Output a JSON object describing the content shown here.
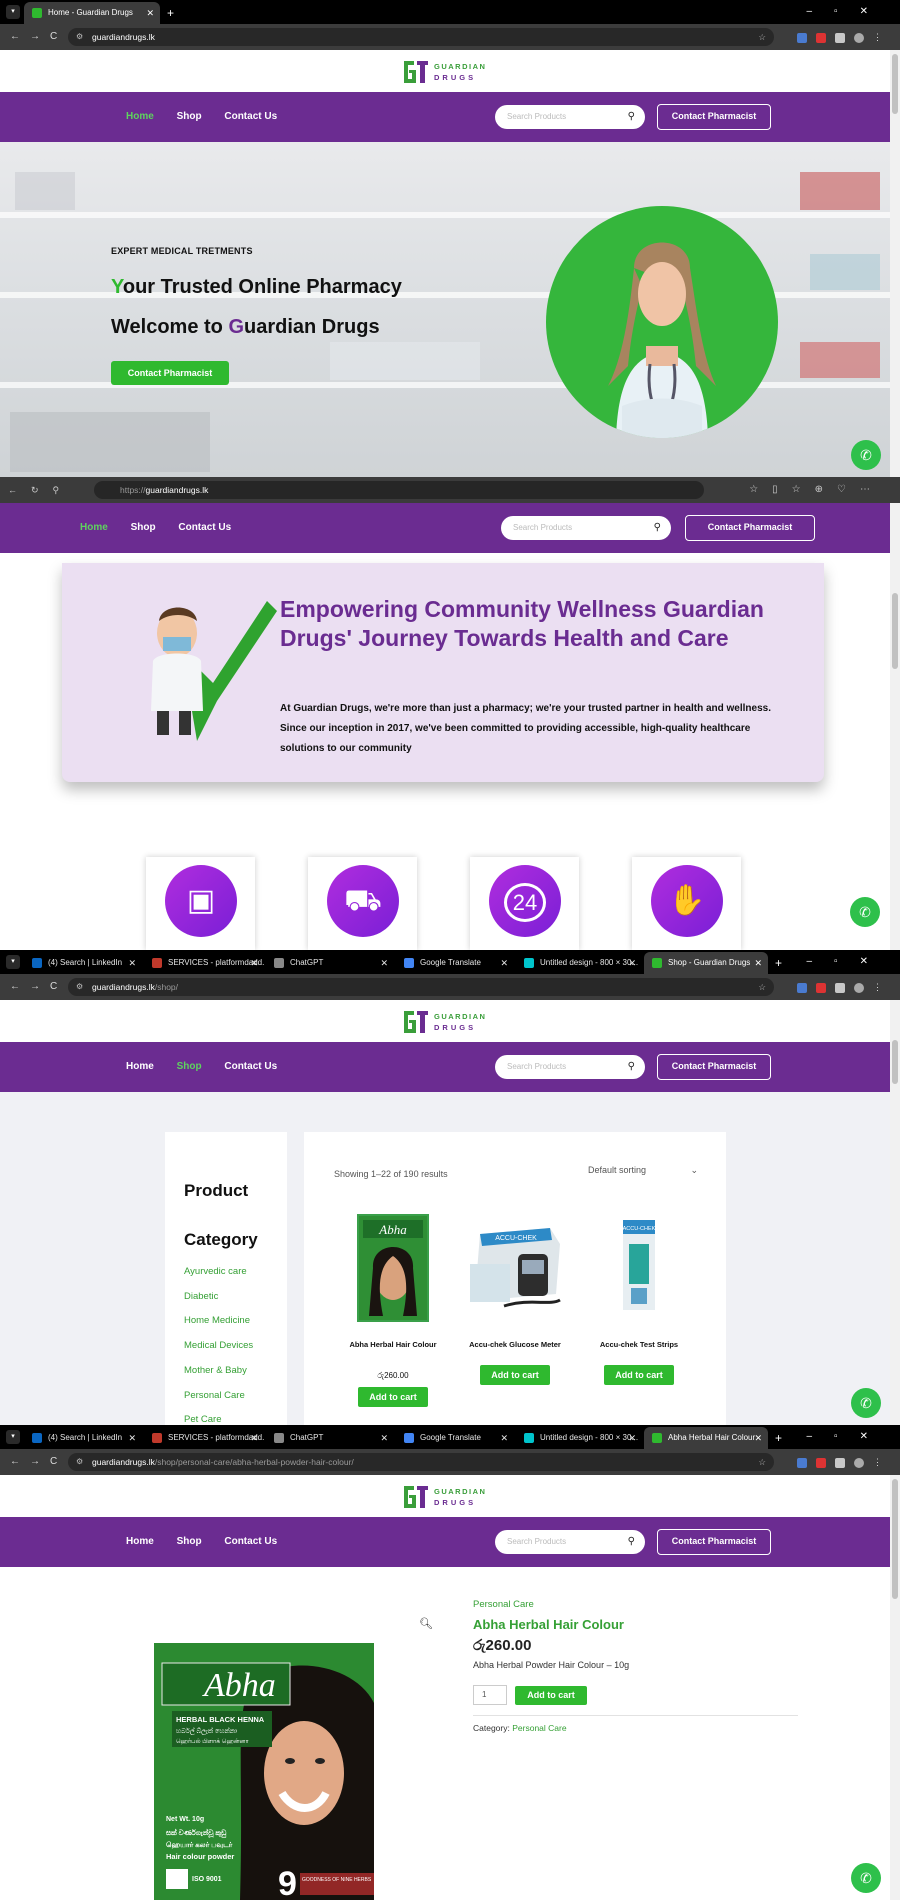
{
  "site": {
    "logo_line1": "GUARDIAN",
    "logo_line2": "DRUGS",
    "nav": [
      "Home",
      "Shop",
      "Contact Us"
    ],
    "search_placeholder": "Search Products",
    "contact_button": "Contact Pharmacist",
    "brand_purple": "#6b2c91",
    "brand_green": "#2fb92f"
  },
  "panel1": {
    "tab_title": "Home - Guardian Drugs",
    "url": "guardiandrugs.lk",
    "hero": {
      "eyebrow": "EXPERT MEDICAL TRETMENTS",
      "headline1_first": "Y",
      "headline1_rest": "our Trusted Online Pharmacy",
      "headline2_a": "Welcome to ",
      "headline2_b": "G",
      "headline2_c": "uardian Drugs",
      "button": "Contact Pharmacist"
    }
  },
  "panel2": {
    "url_prefix": "https://",
    "url_host": "guardiandrugs.lk",
    "about": {
      "heading": "Empowering Community Wellness Guardian Drugs' Journey Towards Health and Care",
      "body": "At Guardian Drugs, we're more than just a pharmacy; we're your trusted partner in health and wellness. Since our inception in 2017, we've been committed to providing accessible, high-quality healthcare solutions to our community"
    },
    "feature_icons": [
      "box-return-icon",
      "delivery-truck-icon",
      "support-24-icon",
      "hand-package-icon"
    ],
    "feature_24_label": "24"
  },
  "tabs_shop": [
    {
      "title": "(4) Search | LinkedIn",
      "color": "#0a66c2"
    },
    {
      "title": "SERVICES - platformdadd...",
      "color": "#c0392b"
    },
    {
      "title": "ChatGPT",
      "color": "#888888"
    },
    {
      "title": "Google Translate",
      "color": "#4285f4"
    },
    {
      "title": "Untitled design - 800 × 30...",
      "color": "#00c4cc"
    }
  ],
  "panel3": {
    "active_tab": "Shop - Guardian Drugs",
    "url_host": "guardiandrugs.lk",
    "url_path": "/shop/",
    "sidebar_title_1": "Product",
    "sidebar_title_2": "Category",
    "categories": [
      "Ayurvedic care",
      "Diabetic",
      "Home Medicine",
      "Medical Devices",
      "Mother & Baby",
      "Personal Care",
      "Pet Care"
    ],
    "results": "Showing 1–22 of 190 results",
    "sorting": "Default sorting",
    "products": [
      {
        "name": "Abha Herbal Hair Colour",
        "price": "රු260.00",
        "button": "Add to cart"
      },
      {
        "name": "Accu-chek Glucose Meter",
        "price": "",
        "button": "Add to cart"
      },
      {
        "name": "Accu-chek Test Strips",
        "price": "",
        "button": "Add to cart"
      }
    ]
  },
  "panel4": {
    "active_tab": "Abha Herbal Hair Colour",
    "url_host": "guardiandrugs.lk",
    "url_path": "/shop/personal-care/abha-herbal-powder-hair-colour/",
    "category": "Personal Care",
    "title": "Abha Herbal Hair Colour",
    "price": "රු260.00",
    "short_desc": "Abha Herbal Powder Hair Colour – 10g",
    "qty": "1",
    "button": "Add to cart",
    "meta_label": "Category:",
    "meta_value": "Personal Care",
    "package": {
      "brand": "Abha",
      "line1": "HERBAL BLACK HENNA",
      "line2": "හර්බල් බ්ලැක් හෙන්නා",
      "line3": "ஹெர்பல் பிளாக் ஹென்னா",
      "net": "Net Wt. 10g",
      "si1": "සක් වර්ණගැන්වූ කුඩු",
      "ta1": "ஹெயார் கலர் பவுடர்",
      "en1": "Hair colour powder",
      "iso": "ISO 9001",
      "nine": "9",
      "goodness": "GOODNESS OF NINE HERBS"
    }
  }
}
